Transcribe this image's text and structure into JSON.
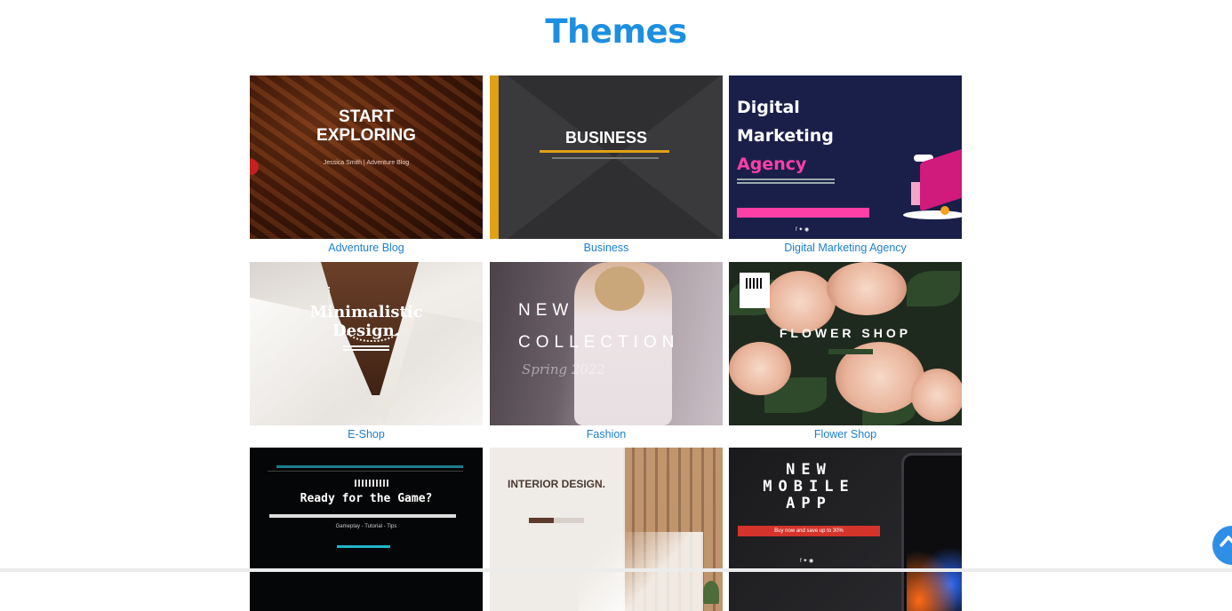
{
  "page": {
    "title": "Themes"
  },
  "themes": [
    {
      "caption": "Adventure Blog",
      "thumb": {
        "heading": "START\nEXPLORING",
        "sub": "Jessica Smith | Adventure Blog"
      }
    },
    {
      "caption": "Business",
      "thumb": {
        "heading": "BUSINESS"
      }
    },
    {
      "caption": "Digital Marketing Agency",
      "thumb": {
        "line1": "Digital",
        "line2": "Marketing",
        "line3": "Agency"
      }
    },
    {
      "caption": "E-Shop",
      "thumb": {
        "heading": "Minimalistic\nDesign."
      }
    },
    {
      "caption": "Fashion",
      "thumb": {
        "line1": "NEW",
        "line2": "COLLECTION",
        "line3": "Spring 2022"
      }
    },
    {
      "caption": "Flower Shop",
      "thumb": {
        "heading": "FLOWER SHOP"
      }
    },
    {
      "caption": "",
      "thumb": {
        "heading": "Ready for the Game?",
        "sub": "Gameplay - Tutorial - Tips"
      }
    },
    {
      "caption": "",
      "thumb": {
        "heading": "INTERIOR DESIGN."
      }
    },
    {
      "caption": "",
      "thumb": {
        "heading": "NEW\nMOBILE\nAPP",
        "banner": "Buy now and save up to 30%"
      }
    }
  ],
  "colors": {
    "title": "#1d8fe1",
    "caption": "#1d7fcf",
    "scroll_button": "#2f8ee6"
  },
  "icons": {
    "scroll_top": "chevron-up-icon"
  }
}
